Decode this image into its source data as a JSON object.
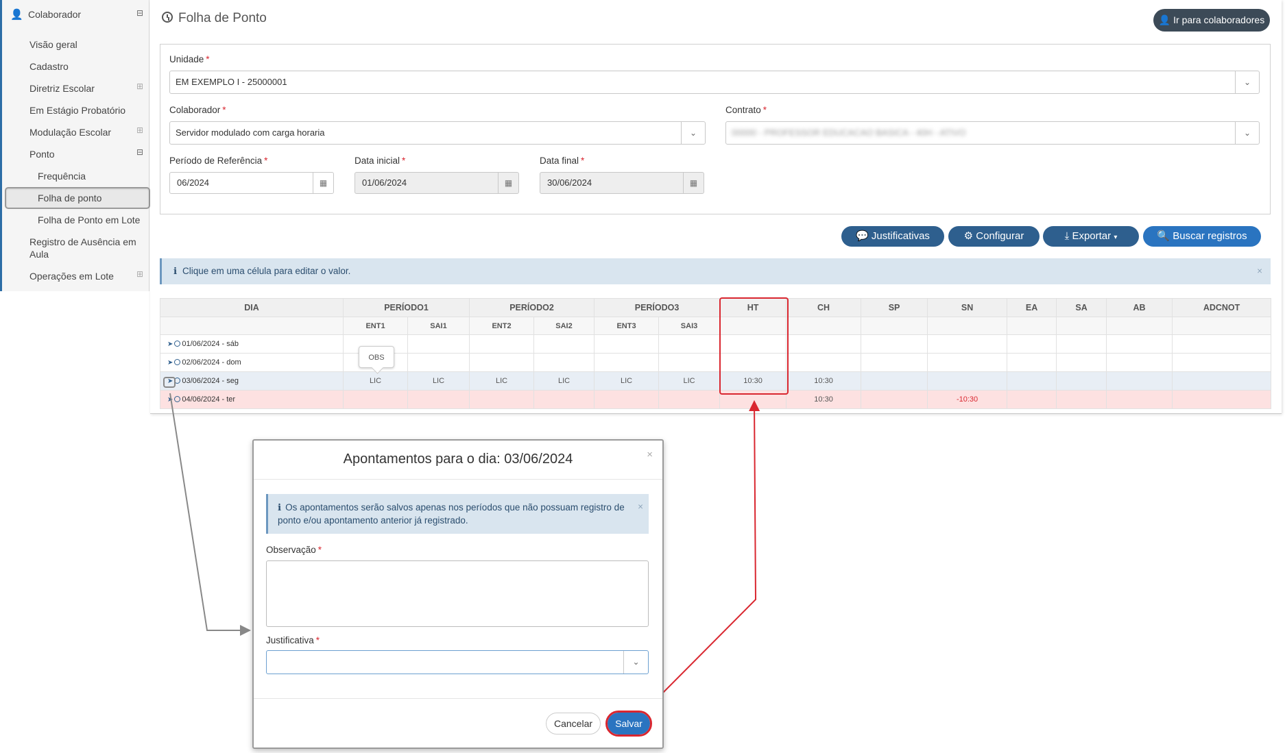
{
  "sidebar": {
    "header": "Colaborador",
    "items": [
      "Visão geral",
      "Cadastro",
      "Diretriz Escolar",
      "Em Estágio Probatório",
      "Modulação Escolar",
      "Ponto"
    ],
    "ponto_sub": [
      "Frequência",
      "Folha de ponto",
      "Folha de Ponto em Lote"
    ],
    "after": [
      "Registro de Ausência em",
      "Aula",
      "Operações em Lote"
    ],
    "toggle_collapse": "⊟",
    "toggle_expand": "⊞"
  },
  "header": {
    "title": "Folha de Ponto",
    "goto_button": "Ir para colaboradores"
  },
  "form": {
    "unidade_label": "Unidade",
    "unidade_value": "EM EXEMPLO I - 25000001",
    "colaborador_label": "Colaborador",
    "colaborador_value": "Servidor modulado com carga horaria",
    "contrato_label": "Contrato",
    "contrato_value": "00000 - PROFESSOR EDUCACAO BASICA - 40H - ATIVO",
    "periodo_label": "Período de Referência",
    "periodo_value": "06/2024",
    "data_inicial_label": "Data inicial",
    "data_inicial_value": "01/06/2024",
    "data_final_label": "Data final",
    "data_final_value": "30/06/2024",
    "required_mark": "*"
  },
  "actions": {
    "justificativas": "Justificativas",
    "configurar": "Configurar",
    "exportar": "Exportar",
    "buscar": "Buscar registros"
  },
  "info_bar": {
    "text": "Clique em uma célula para editar o valor.",
    "icon": "ℹ",
    "close": "×"
  },
  "table": {
    "headers": [
      "DIA",
      "PERÍODO1",
      "PERÍODO2",
      "PERÍODO3",
      "HT",
      "CH",
      "SP",
      "SN",
      "EA",
      "SA",
      "AB",
      "ADCNOT"
    ],
    "subheaders": [
      "ENT1",
      "SAI1",
      "ENT2",
      "SAI2",
      "ENT3",
      "SAI3"
    ],
    "rows": [
      {
        "dia": "01/06/2024 - sáb",
        "cells": [
          "",
          "",
          "",
          "",
          "",
          "",
          "",
          "",
          "",
          "",
          "",
          "",
          ""
        ]
      },
      {
        "dia": "02/06/2024 - dom",
        "cells": [
          "",
          "",
          "",
          "",
          "",
          "",
          "",
          "",
          "",
          "",
          "",
          "",
          ""
        ]
      },
      {
        "dia": "03/06/2024 - seg",
        "cells": [
          "LIC",
          "LIC",
          "LIC",
          "LIC",
          "LIC",
          "LIC",
          "10:30",
          "10:30",
          "",
          "",
          "",
          "",
          ""
        ]
      },
      {
        "dia": "04/06/2024 - ter",
        "cells": [
          "",
          "",
          "",
          "",
          "",
          "",
          "",
          "10:30",
          "",
          "-10:30",
          "",
          "",
          ""
        ]
      }
    ],
    "tooltip": "OBS"
  },
  "modal": {
    "title": "Apontamentos para o dia: 03/06/2024",
    "close": "×",
    "info": "Os apontamentos serão salvos apenas nos períodos que não possuam registro de ponto e/ou apontamento anterior já registrado.",
    "observacao_label": "Observação",
    "justificativa_label": "Justificativa",
    "cancel": "Cancelar",
    "save": "Salvar"
  },
  "colors": {
    "accent": "#2a74c0",
    "highlight": "#d9262f",
    "dark_button": "#3c4a57"
  }
}
